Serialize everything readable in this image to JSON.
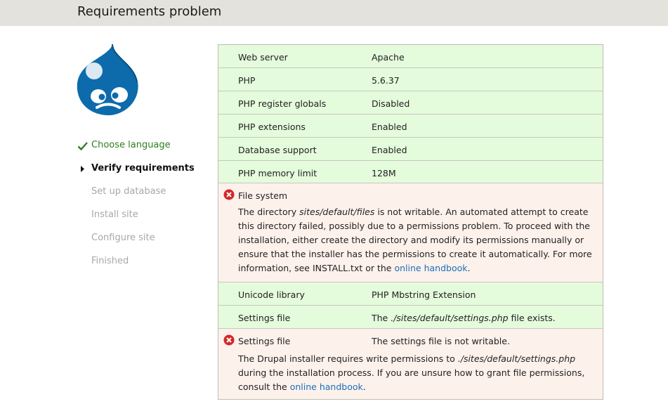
{
  "header": {
    "title": "Requirements problem"
  },
  "steps": [
    {
      "label": "Choose language",
      "state": "done"
    },
    {
      "label": "Verify requirements",
      "state": "active"
    },
    {
      "label": "Set up database",
      "state": "pending"
    },
    {
      "label": "Install site",
      "state": "pending"
    },
    {
      "label": "Configure site",
      "state": "pending"
    },
    {
      "label": "Finished",
      "state": "pending"
    }
  ],
  "requirements": {
    "web_server": {
      "title": "Web server",
      "value": "Apache"
    },
    "php": {
      "title": "PHP",
      "value": "5.6.37"
    },
    "register_globals": {
      "title": "PHP register globals",
      "value": "Disabled"
    },
    "extensions": {
      "title": "PHP extensions",
      "value": "Enabled"
    },
    "database": {
      "title": "Database support",
      "value": "Enabled"
    },
    "memory": {
      "title": "PHP memory limit",
      "value": "128M"
    },
    "file_system": {
      "title": "File system",
      "desc_1": "The directory ",
      "desc_path": "sites/default/files",
      "desc_2": " is not writable. An automated attempt to create this directory failed, possibly due to a permissions problem. To proceed with the installation, either create the directory and modify its permissions manually or ensure that the installer has the permissions to create it automatically. For more information, see INSTALL.txt or the ",
      "desc_link": "online handbook",
      "desc_3": "."
    },
    "unicode": {
      "title": "Unicode library",
      "value": "PHP Mbstring Extension"
    },
    "settings_exists": {
      "title": "Settings file",
      "value_1": "The ",
      "value_path": "./sites/default/settings.php",
      "value_2": " file exists."
    },
    "settings_writable": {
      "title": "Settings file",
      "value": "The settings file is not writable.",
      "desc_1": "The Drupal installer requires write permissions to ",
      "desc_path": "./sites/default/settings.php",
      "desc_2": " during the installation process. If you are unsure how to grant file permissions, consult the ",
      "desc_link": "online handbook",
      "desc_3": "."
    }
  },
  "colors": {
    "ok_row": "#e4fbdc",
    "error_row": "#fdf1ec",
    "link": "#1a6fb7",
    "done_step": "#2e7d1f",
    "error_icon": "#d42727"
  }
}
